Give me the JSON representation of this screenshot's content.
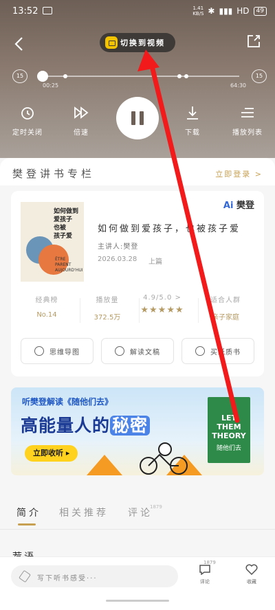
{
  "status_bar": {
    "time": "13:52",
    "network_speed": "1.41\nKB/S",
    "network_type": "HD",
    "battery": "49"
  },
  "player": {
    "switch_label": "切换到视频",
    "time_current": "00:25",
    "time_total": "64:30",
    "skip_back": "15",
    "skip_forward": "15",
    "controls": {
      "timer": "定时关闭",
      "speed": "倍速",
      "download": "下载",
      "playlist": "播放列表"
    }
  },
  "column": {
    "title": "樊登讲书专栏",
    "login_link": "立即登录 >"
  },
  "book": {
    "brand": "樊登",
    "brand_ai": "Ai",
    "title": "如何做到爱孩子，也被孩子爱",
    "lecturer": "主讲人:樊登",
    "date": "2026.03.28",
    "part": "上篇",
    "cover_title": "如何做到\n爱孩子\n也被\n孩子爱",
    "cover_foreign": "ÊTRE\nPARENT\nAUJOURD'HUI",
    "stats": {
      "rank_label": "经典榜",
      "rank_value": "No.14",
      "plays_label": "播放量",
      "plays_value": "372.5万",
      "rating_label": "4.9/5.0 >",
      "rating_stars": "★★★★★",
      "tag_label": "适合人群",
      "tag_value": "亲子家庭"
    },
    "actions": {
      "mindmap": "思维导图",
      "transcript": "解读文稿",
      "buy": "买纸质书"
    }
  },
  "banner": {
    "subtitle": "听樊登解读《随他们去》",
    "headline_pre": "高能量人的",
    "headline_hl": "秘密",
    "cta": "立即收听 ▸",
    "book_title": "LET\nTHEM\nTHEORY",
    "book_cn": "随他们去"
  },
  "tabs": {
    "intro": "简介",
    "related": "相关推荐",
    "comments": "评论",
    "comments_count": "1879"
  },
  "section": {
    "title": "荐语"
  },
  "bottom_bar": {
    "placeholder": "写下听书感受···",
    "comment_label": "评论",
    "comment_count": "1879",
    "favorite_label": "收藏"
  },
  "colors": {
    "accent": "#c7a052",
    "annotation_arrow": "#f21a1a",
    "banner_cta": "#ffd21f"
  }
}
